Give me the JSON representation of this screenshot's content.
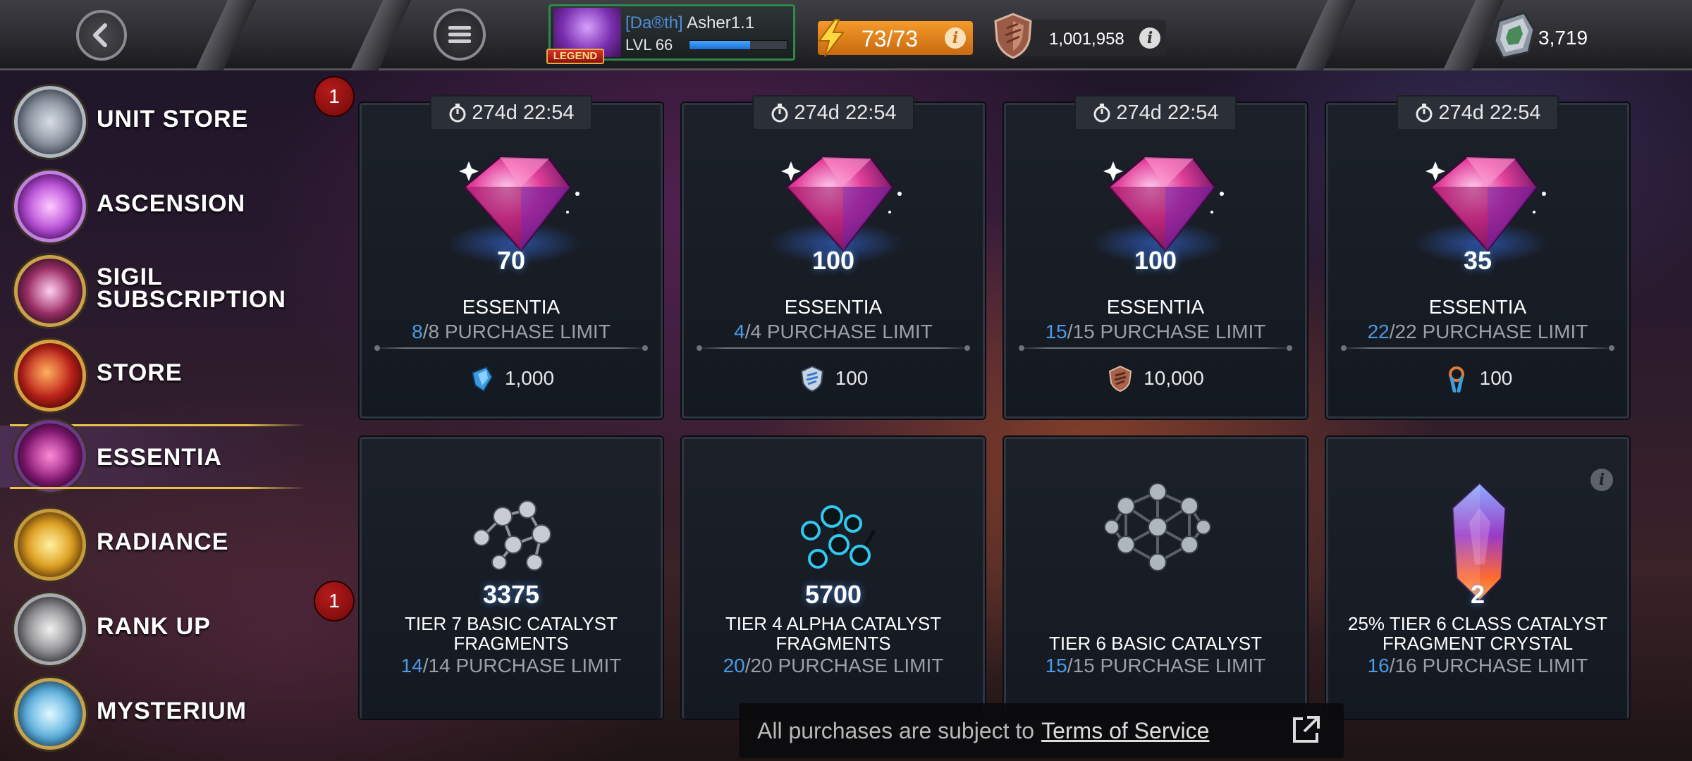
{
  "header": {
    "profile": {
      "alliance_tag": "[Da®th]",
      "player_name": "Asher1.1",
      "level_text": "LVL 66",
      "level_progress": 0.62,
      "rank_tag": "LEGEND"
    },
    "energy": {
      "value": "73/73"
    },
    "battlechips": {
      "value": "1,001,958"
    },
    "units": {
      "value": "3,719"
    }
  },
  "sidebar": {
    "items": [
      {
        "label_lines": [
          "UNIT STORE"
        ],
        "icon": "unit-crystal-icon"
      },
      {
        "label_lines": [
          "ASCENSION"
        ],
        "icon": "ascension-icon"
      },
      {
        "label_lines": [
          "SIGIL",
          "SUBSCRIPTION"
        ],
        "icon": "sigil-icon"
      },
      {
        "label_lines": [
          "STORE"
        ],
        "icon": "store-icon"
      },
      {
        "label_lines": [
          "ESSENTIA"
        ],
        "icon": "essentia-icon",
        "active": true
      },
      {
        "label_lines": [
          "RADIANCE"
        ],
        "icon": "radiance-icon"
      },
      {
        "label_lines": [
          "RANK UP"
        ],
        "icon": "rank-up-icon"
      },
      {
        "label_lines": [
          "MYSTERIUM"
        ],
        "icon": "mysterium-icon"
      }
    ],
    "badges": [
      "1",
      "1"
    ]
  },
  "offers_top": [
    {
      "timer": "274d 22:54",
      "qty": "70",
      "title": "ESSENTIA",
      "limit_cur": "8",
      "limit_rest": "/8 PURCHASE LIMIT",
      "price": "1,000",
      "currency_icon": "gold-crystal-shard-icon"
    },
    {
      "timer": "274d 22:54",
      "qty": "100",
      "title": "ESSENTIA",
      "limit_cur": "4",
      "limit_rest": "/4 PURCHASE LIMIT",
      "price": "100",
      "currency_icon": "alliance-token-icon"
    },
    {
      "timer": "274d 22:54",
      "qty": "100",
      "title": "ESSENTIA",
      "limit_cur": "15",
      "limit_rest": "/15 PURCHASE LIMIT",
      "price": "10,000",
      "currency_icon": "battlechip-icon"
    },
    {
      "timer": "274d 22:54",
      "qty": "35",
      "title": "ESSENTIA",
      "limit_cur": "22",
      "limit_rest": "/22 PURCHASE LIMIT",
      "price": "100",
      "currency_icon": "glory-icon"
    }
  ],
  "offers_bottom": [
    {
      "qty": "3375",
      "title_lines": [
        "TIER 7 BASIC CATALYST",
        "FRAGMENTS"
      ],
      "limit_cur": "14",
      "limit_rest": "/14 PURCHASE LIMIT",
      "icon": "t7-basic-fragments-icon"
    },
    {
      "qty": "5700",
      "title_lines": [
        "TIER 4 ALPHA CATALYST",
        "FRAGMENTS"
      ],
      "limit_cur": "20",
      "limit_rest": "/20 PURCHASE LIMIT",
      "icon": "t4-alpha-fragments-icon"
    },
    {
      "qty": "",
      "title_lines": [
        "",
        "TIER 6 BASIC CATALYST"
      ],
      "limit_cur": "15",
      "limit_rest": "/15 PURCHASE LIMIT",
      "icon": "t6-basic-catalyst-icon"
    },
    {
      "qty": "2",
      "title_lines": [
        "25% TIER 6 CLASS CATALYST",
        "FRAGMENT CRYSTAL"
      ],
      "limit_cur": "16",
      "limit_rest": "/16 PURCHASE LIMIT",
      "icon": "t6-class-crystal-icon",
      "has_info": true
    }
  ],
  "footer": {
    "text": "All purchases are subject to",
    "link": "Terms of Service"
  },
  "colors": {
    "accent_gold": "#e9c24a",
    "limit_blue": "#4a9ae8",
    "energy_orange": "#f49a2a",
    "badge_red": "#b81c1c"
  }
}
